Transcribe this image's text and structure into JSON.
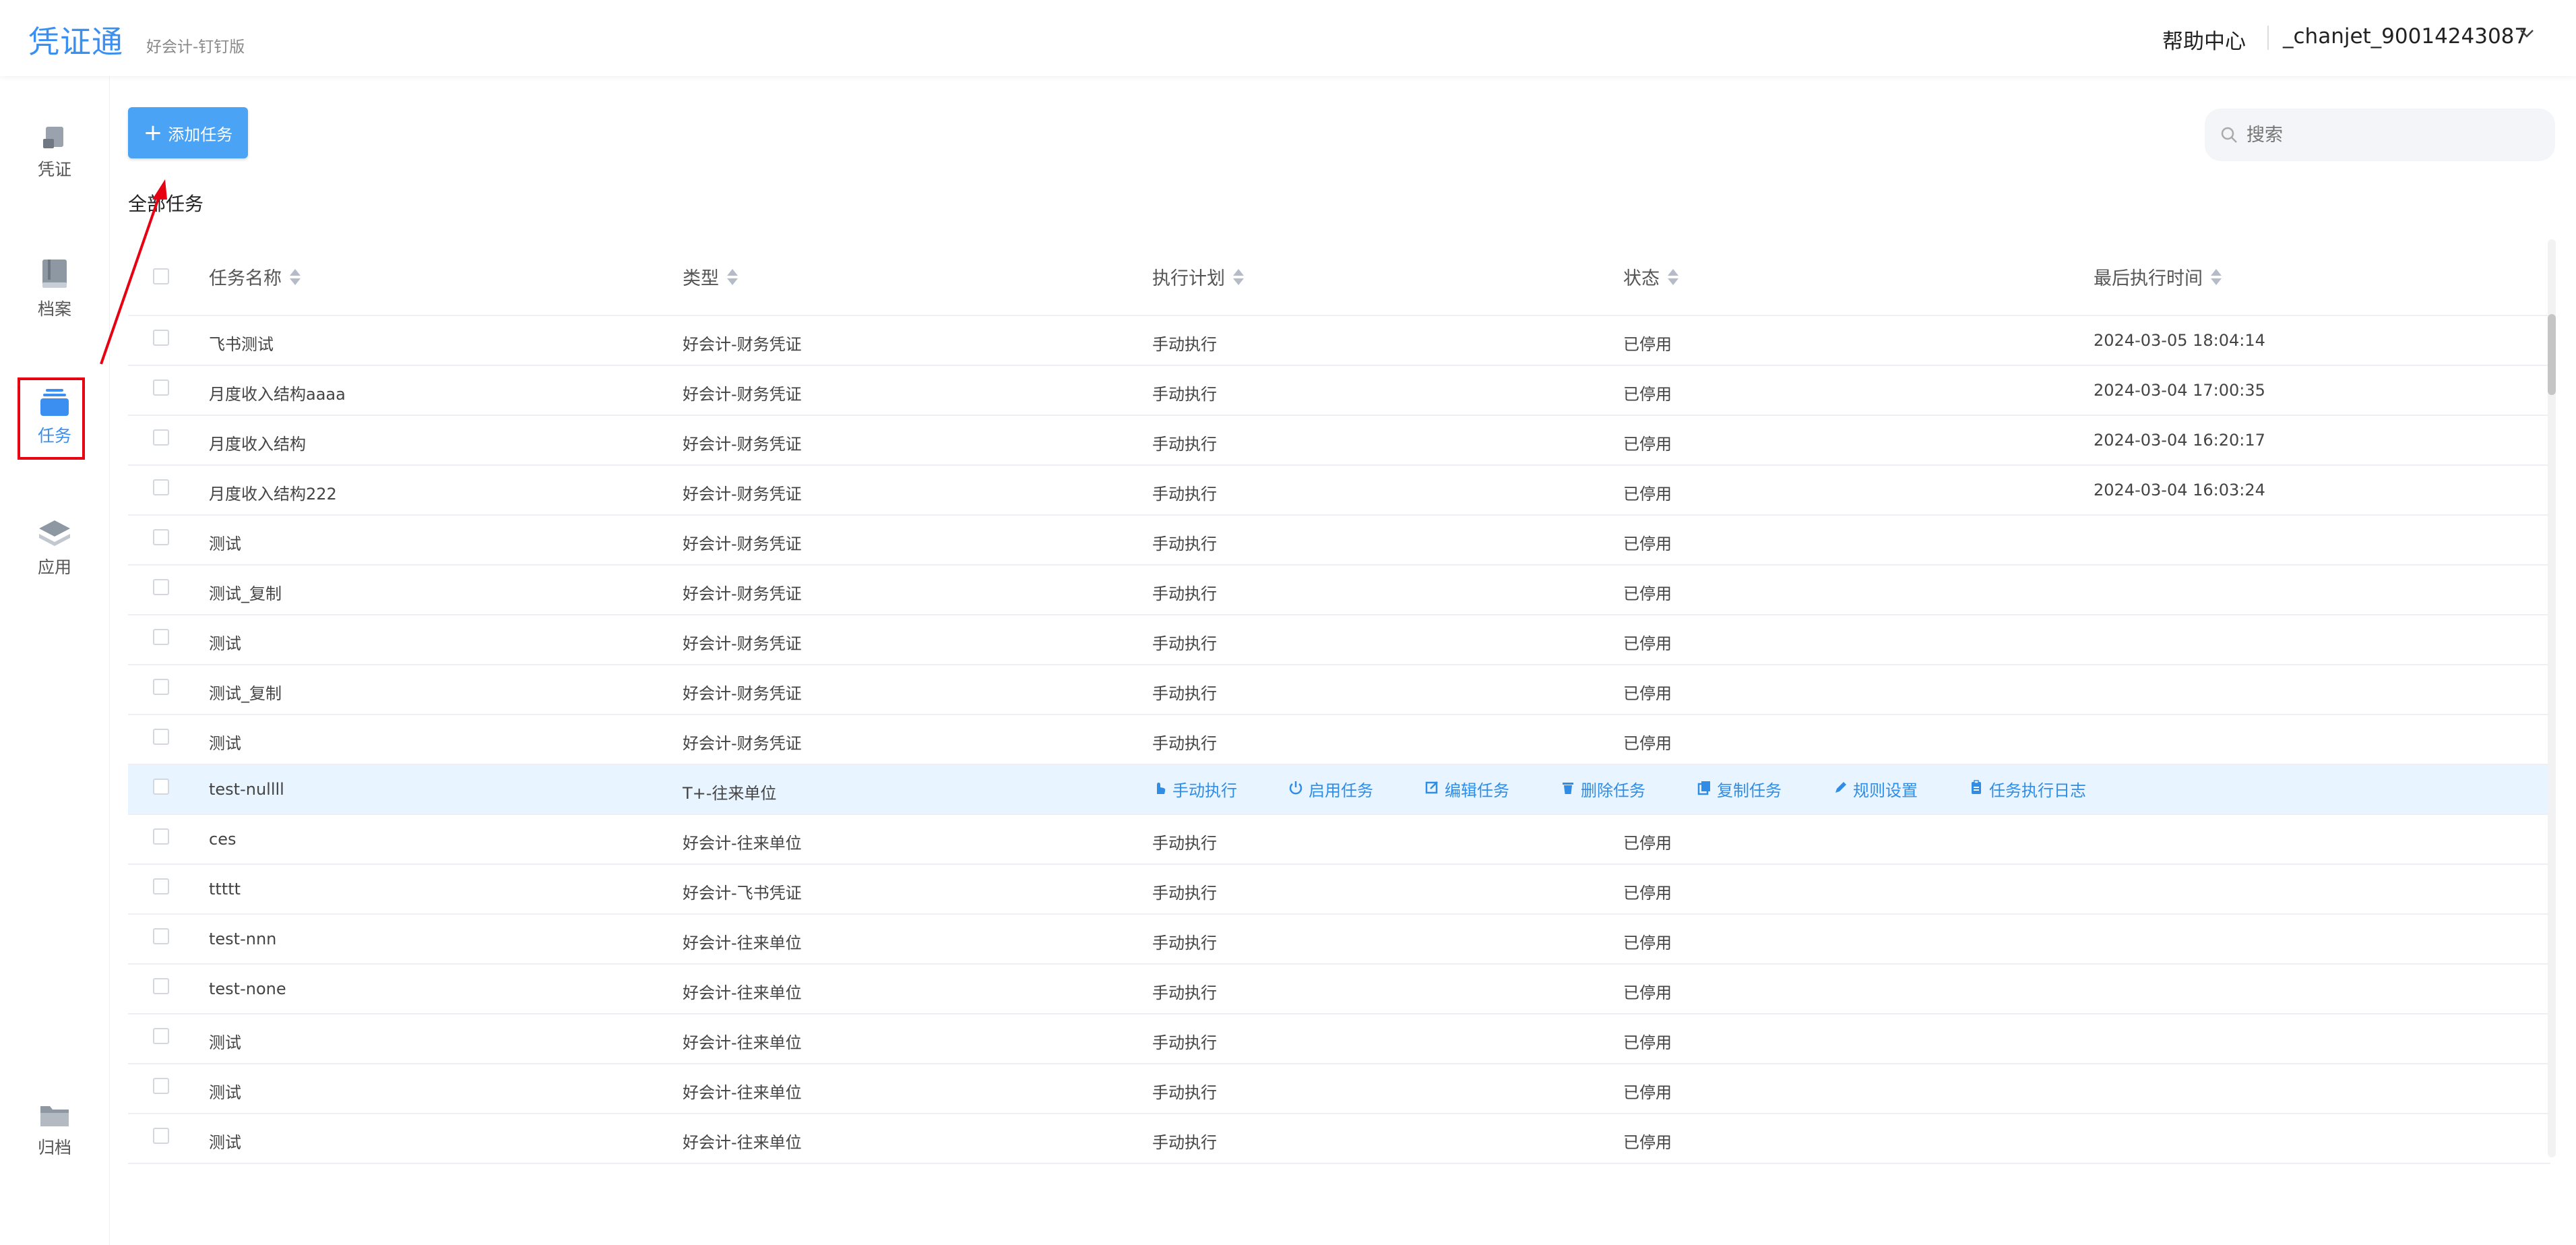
{
  "header": {
    "logo": "凭证通",
    "edition": "好会计-钉钉版",
    "help": "帮助中心",
    "user": "_chanjet_90014243087"
  },
  "sidebar": {
    "items": [
      {
        "label": "凭证",
        "icon": "voucher-icon"
      },
      {
        "label": "档案",
        "icon": "book-icon"
      },
      {
        "label": "任务",
        "icon": "task-icon",
        "active": true
      },
      {
        "label": "应用",
        "icon": "layers-icon"
      },
      {
        "label": "归档",
        "icon": "folder-icon"
      }
    ]
  },
  "toolbar": {
    "add_label": "添加任务",
    "search_placeholder": "搜索"
  },
  "section_title": "全部任务",
  "table": {
    "columns": [
      "任务名称",
      "类型",
      "执行计划",
      "状态",
      "最后执行时间"
    ],
    "rows": [
      {
        "name": "飞书测试",
        "type": "好会计-财务凭证",
        "plan": "手动执行",
        "status": "已停用",
        "time": "2024-03-05 18:04:14"
      },
      {
        "name": "月度收入结构aaaa",
        "type": "好会计-财务凭证",
        "plan": "手动执行",
        "status": "已停用",
        "time": "2024-03-04 17:00:35"
      },
      {
        "name": "月度收入结构",
        "type": "好会计-财务凭证",
        "plan": "手动执行",
        "status": "已停用",
        "time": "2024-03-04 16:20:17"
      },
      {
        "name": "月度收入结构222",
        "type": "好会计-财务凭证",
        "plan": "手动执行",
        "status": "已停用",
        "time": "2024-03-04 16:03:24"
      },
      {
        "name": "测试",
        "type": "好会计-财务凭证",
        "plan": "手动执行",
        "status": "已停用",
        "time": ""
      },
      {
        "name": "测试_复制",
        "type": "好会计-财务凭证",
        "plan": "手动执行",
        "status": "已停用",
        "time": ""
      },
      {
        "name": "测试",
        "type": "好会计-财务凭证",
        "plan": "手动执行",
        "status": "已停用",
        "time": ""
      },
      {
        "name": "测试_复制",
        "type": "好会计-财务凭证",
        "plan": "手动执行",
        "status": "已停用",
        "time": ""
      },
      {
        "name": "测试",
        "type": "好会计-财务凭证",
        "plan": "手动执行",
        "status": "已停用",
        "time": ""
      },
      {
        "name": "test-nullll",
        "type": "T+-往来单位",
        "plan": "",
        "status": "",
        "time": ""
      },
      {
        "name": "ces",
        "type": "好会计-往来单位",
        "plan": "手动执行",
        "status": "已停用",
        "time": ""
      },
      {
        "name": "ttttt",
        "type": "好会计-飞书凭证",
        "plan": "手动执行",
        "status": "已停用",
        "time": ""
      },
      {
        "name": "test-nnn",
        "type": "好会计-往来单位",
        "plan": "手动执行",
        "status": "已停用",
        "time": ""
      },
      {
        "name": "test-none",
        "type": "好会计-往来单位",
        "plan": "手动执行",
        "status": "已停用",
        "time": ""
      },
      {
        "name": "测试",
        "type": "好会计-往来单位",
        "plan": "手动执行",
        "status": "已停用",
        "time": ""
      },
      {
        "name": "测试",
        "type": "好会计-往来单位",
        "plan": "手动执行",
        "status": "已停用",
        "time": ""
      },
      {
        "name": "测试",
        "type": "好会计-往来单位",
        "plan": "手动执行",
        "status": "已停用",
        "time": ""
      }
    ],
    "hover_actions": [
      "手动执行",
      "启用任务",
      "编辑任务",
      "删除任务",
      "复制任务",
      "规则设置",
      "任务执行日志"
    ]
  },
  "colors": {
    "accent": "#3a8ff0",
    "button": "#4aa3f5",
    "annotation": "#e60012",
    "hover_row": "#e8f4ff"
  }
}
